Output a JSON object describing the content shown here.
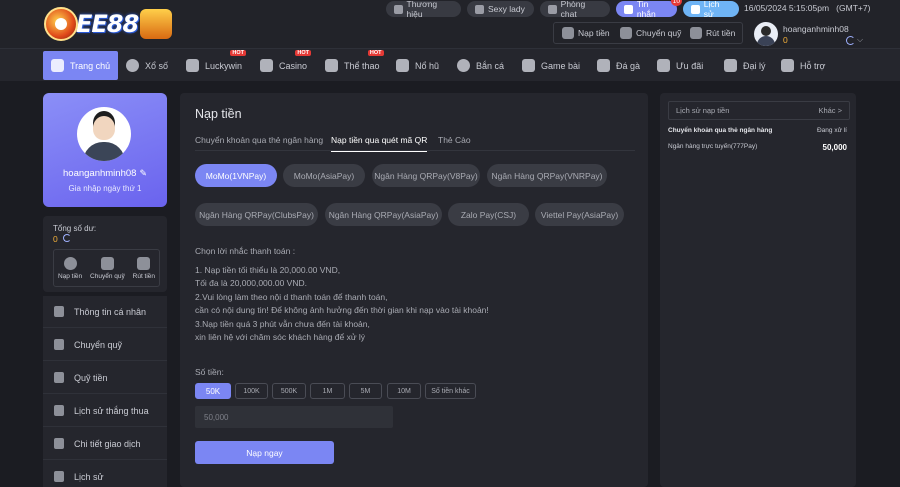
{
  "header": {
    "logo_text": "EE88",
    "pills": [
      {
        "label": "Thương hiệu"
      },
      {
        "label": "Sexy lady"
      },
      {
        "label": "Phòng chat"
      },
      {
        "label": "Tin nhắn",
        "badge": "10"
      },
      {
        "label": "Lịch sử"
      }
    ],
    "datetime": "16/05/2024 5:15:05pm",
    "timezone": "(GMT+7)",
    "quick": {
      "deposit": "Nạp tiền",
      "transfer": "Chuyển quỹ",
      "withdraw": "Rút tiền"
    },
    "username": "hoanganhminh08",
    "balance": "0"
  },
  "nav": {
    "items": [
      {
        "label": "Trang chủ",
        "active": true
      },
      {
        "label": "Xổ số"
      },
      {
        "label": "Luckywin",
        "hot": "HOT"
      },
      {
        "label": "Casino",
        "hot": "HOT"
      },
      {
        "label": "Thể thao",
        "hot": "HOT"
      },
      {
        "label": "Nổ hũ"
      },
      {
        "label": "Bắn cá"
      },
      {
        "label": "Game bài"
      },
      {
        "label": "Đá gà"
      },
      {
        "label": "Ưu đãi"
      },
      {
        "label": "Đại lý"
      },
      {
        "label": "Hỗ trợ"
      }
    ]
  },
  "profile": {
    "username": "hoanganhminh08",
    "joined": "Gia nhập ngày thứ 1",
    "balance_label": "Tổng số dư:",
    "balance": "0",
    "actions": [
      "Nạp tiền",
      "Chuyển quỹ",
      "Rút tiền"
    ]
  },
  "menu": {
    "items": [
      "Thông tin cá nhân",
      "Chuyển quỹ",
      "Quỹ tiền",
      "Lịch sử thắng thua",
      "Chi tiết giao dịch",
      "Lịch sử"
    ]
  },
  "main": {
    "title": "Nạp tiền",
    "tabs": [
      {
        "label": "Chuyển khoản qua thẻ ngân hàng"
      },
      {
        "label": "Nạp tiền qua quét mã QR",
        "active": true
      },
      {
        "label": "Thẻ Cào"
      }
    ],
    "methods": [
      "MoMo(1VNPay)",
      "MoMo(AsiaPay)",
      "Ngân Hàng QRPay(V8Pay)",
      "Ngân Hàng QRPay(VNRPay)",
      "Ngân Hàng QRPay(ClubsPay)",
      "Ngân Hàng QRPay(AsiaPay)",
      "Zalo Pay(CSJ)",
      "Viettel Pay(AsiaPay)"
    ],
    "active_method": "MoMo(1VNPay)",
    "notes_title": "Chọn lời nhắc thanh toán :",
    "notes": [
      "1. Nạp tiền tối thiểu là 20,000.00 VND,",
      "Tối đa là 20,000,000.00 VND.",
      "2.Vui lòng làm theo nội d thanh toán để thanh toán,",
      "cần có nội dung tin! Để không ảnh hưởng đến thời gian khi nạp  vào tài khoản!",
      "3.Nạp tiền quá 3 phút vẫn chưa đến tài khoản,",
      "xin liên hệ với chăm sóc khách hàng để xử lý"
    ],
    "amount_label": "Số tiền:",
    "amounts": [
      "50K",
      "100K",
      "500K",
      "1M",
      "5M",
      "10M",
      "Số tiền khác"
    ],
    "active_amount": "50K",
    "amount_value": "50,000",
    "submit_label": "Nạp ngay"
  },
  "history": {
    "title": "Lịch sử nạp tiền",
    "more": "Khác >",
    "rows": [
      {
        "left": "Chuyển khoản qua thẻ ngân hàng",
        "right": "Đang xử lí"
      },
      {
        "left": "Ngân hàng trực tuyến(777Pay)",
        "right": "50,000"
      }
    ]
  },
  "colors": {
    "accent": "#7b86f3",
    "gold": "#f3b03a",
    "background": "#1b1c22",
    "panel": "#25262d"
  }
}
